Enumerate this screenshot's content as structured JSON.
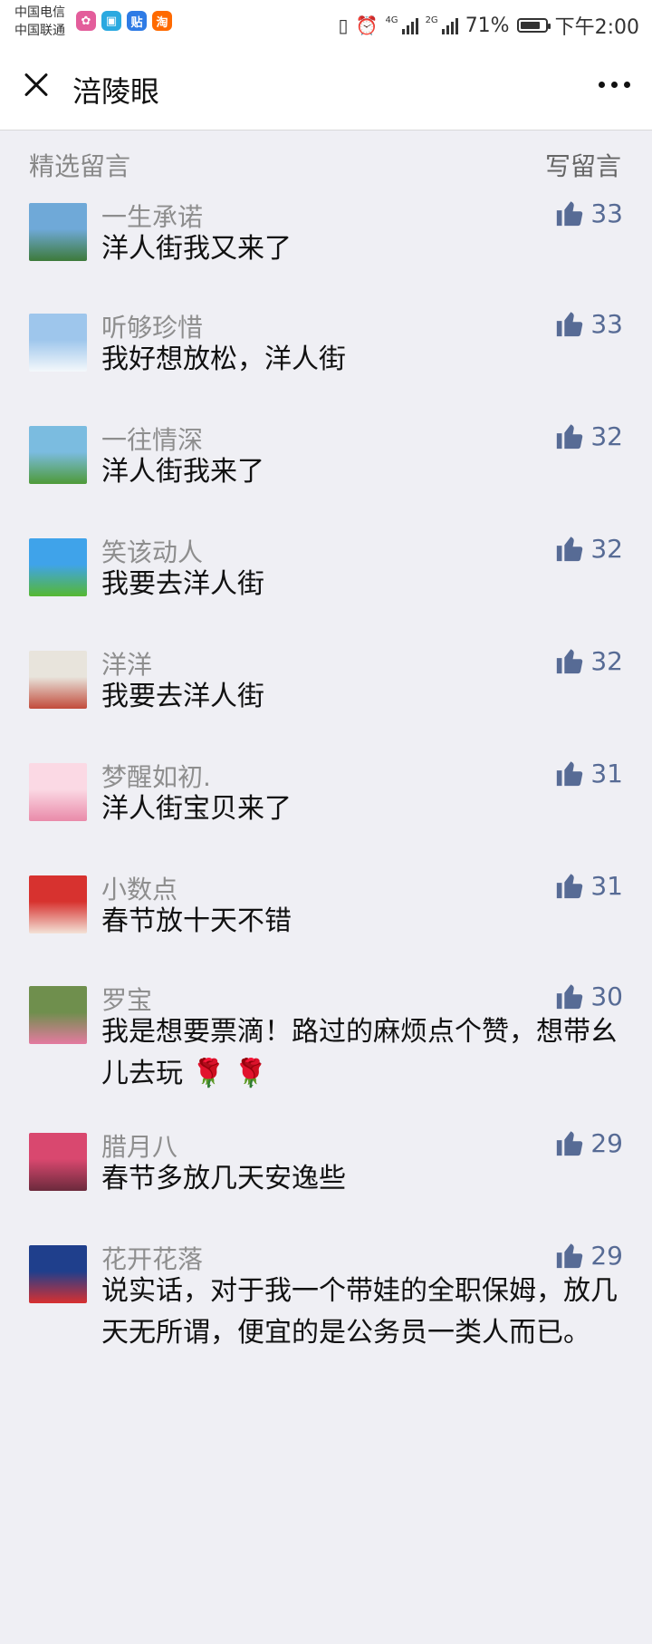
{
  "status_bar": {
    "carrier_1": "中国电信",
    "carrier_2": "中国联通",
    "app_icons": [
      {
        "name": "photos-app-icon",
        "glyph": "✿",
        "color": "#e35d9b"
      },
      {
        "name": "store-app-icon",
        "glyph": "▣",
        "color": "#2aa9e0"
      },
      {
        "name": "tieba-app-icon",
        "glyph": "贴",
        "color": "#2e7be5"
      },
      {
        "name": "taobao-app-icon",
        "glyph": "淘",
        "color": "#ff6a00"
      }
    ],
    "network_1": "4G",
    "network_2": "2G",
    "battery_text": "71%",
    "time": "下午2:00"
  },
  "nav": {
    "title": "涪陵眼"
  },
  "section": {
    "title": "精选留言",
    "write_label": "写留言"
  },
  "comments": [
    {
      "nickname": "一生承诺",
      "text": "洋人街我又来了",
      "likes": "33",
      "avatar_colors": [
        "#6fa9d8",
        "#3d7a3a"
      ]
    },
    {
      "nickname": "听够珍惜",
      "text": "我好想放松，洋人街",
      "likes": "33",
      "avatar_colors": [
        "#9ec6ec",
        "#f4f8fb"
      ]
    },
    {
      "nickname": "一往情深",
      "text": "洋人街我来了",
      "likes": "32",
      "avatar_colors": [
        "#7bbce0",
        "#4e9a38"
      ]
    },
    {
      "nickname": "笑该动人",
      "text": "我要去洋人街",
      "likes": "32",
      "avatar_colors": [
        "#3fa3ea",
        "#56b832"
      ]
    },
    {
      "nickname": "洋洋",
      "text": "我要去洋人街",
      "likes": "32",
      "avatar_colors": [
        "#e8e4dc",
        "#c24b3b"
      ]
    },
    {
      "nickname": "梦醒如初.",
      "text": "洋人街宝贝来了",
      "likes": "31",
      "avatar_colors": [
        "#fbd9e4",
        "#e98aa9"
      ]
    },
    {
      "nickname": "小数点",
      "text": "春节放十天不错",
      "likes": "31",
      "avatar_colors": [
        "#d7322f",
        "#f3e1d6"
      ]
    },
    {
      "nickname": "罗宝",
      "text": "我是想要票滴！路过的麻烦点个赞，想带幺儿去玩 🌹 🌹",
      "likes": "30",
      "avatar_colors": [
        "#6f8f4d",
        "#e47aa0"
      ]
    },
    {
      "nickname": "腊月八",
      "text": "春节多放几天安逸些",
      "likes": "29",
      "avatar_colors": [
        "#d9486f",
        "#6b2a3c"
      ]
    },
    {
      "nickname": "花开花落",
      "text": "说实话，对于我一个带娃的全职保姆，放几天无所谓，便宜的是公务员一类人而已。",
      "likes": "29",
      "avatar_colors": [
        "#1f3f8c",
        "#d83030"
      ]
    }
  ]
}
